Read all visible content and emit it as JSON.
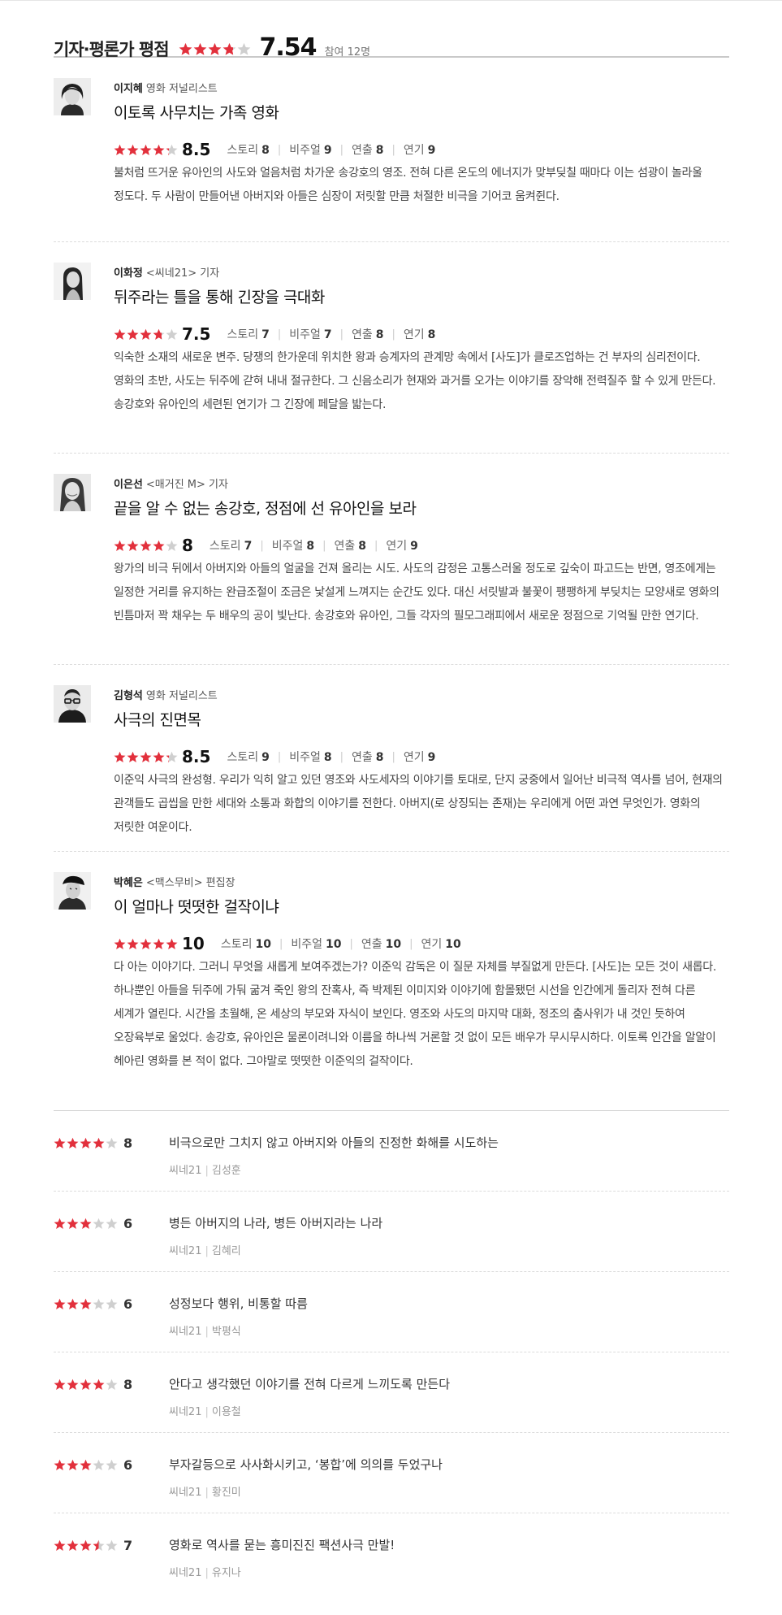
{
  "header": {
    "title": "기자·평론가 평점",
    "rating": 3.77,
    "score": "7.54",
    "participants": "참여 12명"
  },
  "colors": {
    "star_on": "#e2303c",
    "star_off": "#cfcfcf"
  },
  "reviews": [
    {
      "name": "이지혜",
      "role": "영화 저널리스트",
      "title": "이토록 사무치는 가족 영화",
      "rating": 4.25,
      "score": "8.5",
      "sub": [
        {
          "label": "스토리",
          "value": "8"
        },
        {
          "label": "비주얼",
          "value": "9"
        },
        {
          "label": "연출",
          "value": "8"
        },
        {
          "label": "연기",
          "value": "9"
        }
      ],
      "comment": "불처럼 뜨거운 유아인의 사도와 얼음처럼 차가운 송강호의 영조. 전혀 다른 온도의 에너지가 맞부딪칠 때마다 이는 섬광이 놀라울 정도다. 두 사람이 만들어낸 아버지와 아들은 심장이 저릿할 만큼 처절한 비극을 기어코 움켜쥔다.",
      "avatar": "woman-short-hair-icon"
    },
    {
      "name": "이화정",
      "role": "<씨네21> 기자",
      "title": "뒤주라는 틀을 통해 긴장을 극대화",
      "rating": 3.75,
      "score": "7.5",
      "sub": [
        {
          "label": "스토리",
          "value": "7"
        },
        {
          "label": "비주얼",
          "value": "7"
        },
        {
          "label": "연출",
          "value": "8"
        },
        {
          "label": "연기",
          "value": "8"
        }
      ],
      "comment": "익숙한 소재의 새로운 변주. 당쟁의 한가운데 위치한 왕과 승계자의 관계망 속에서 [사도]가 클로즈업하는 건 부자의 심리전이다. 영화의 초반, 사도는 뒤주에 갇혀 내내 절규한다. 그 신음소리가 현재와 과거를 오가는 이야기를 장악해 전력질주 할 수 있게 만든다. 송강호와 유아인의 세련된 연기가 그 긴장에 페달을 밟는다.",
      "avatar": "woman-long-hair-icon"
    },
    {
      "name": "이은선",
      "role": "<매거진 M> 기자",
      "title": "끝을 알 수 없는 송강호, 정점에 선 유아인을 보라",
      "rating": 4,
      "score": "8",
      "sub": [
        {
          "label": "스토리",
          "value": "7"
        },
        {
          "label": "비주얼",
          "value": "8"
        },
        {
          "label": "연출",
          "value": "8"
        },
        {
          "label": "연기",
          "value": "9"
        }
      ],
      "comment": "왕가의 비극 뒤에서 아버지와 아들의 얼굴을 건져 올리는 시도. 사도의 감정은 고통스러울 정도로 깊숙이 파고드는 반면, 영조에게는 일정한 거리를 유지하는 완급조절이 조금은 낯설게 느껴지는 순간도 있다. 대신 서릿발과 불꽃이 팽팽하게 부딪치는 모양새로 영화의 빈틈마저 꽉 채우는 두 배우의 공이 빛난다. 송강호와 유아인, 그들 각자의 필모그래피에서 새로운 정점으로 기억될 만한 연기다.",
      "avatar": "woman-smiling-icon"
    },
    {
      "name": "김형석",
      "role": "영화 저널리스트",
      "title": "사극의 진면목",
      "rating": 4.25,
      "score": "8.5",
      "sub": [
        {
          "label": "스토리",
          "value": "9"
        },
        {
          "label": "비주얼",
          "value": "8"
        },
        {
          "label": "연출",
          "value": "8"
        },
        {
          "label": "연기",
          "value": "9"
        }
      ],
      "comment": "이준익 사극의 완성형. 우리가 익히 알고 있던 영조와 사도세자의 이야기를 토대로, 단지 궁중에서 일어난 비극적 역사를 넘어, 현재의 관객들도 곱씹을 만한 세대와 소통과 화합의 이야기를 전한다. 아버지(로 상징되는 존재)는 우리에게 어떤 과연 무엇인가. 영화의 저릿한 여운이다.",
      "avatar": "man-glasses-icon"
    },
    {
      "name": "박혜은",
      "role": "<맥스무비> 편집장",
      "title": "이 얼마나 떳떳한 걸작이냐",
      "rating": 5,
      "score": "10",
      "sub": [
        {
          "label": "스토리",
          "value": "10"
        },
        {
          "label": "비주얼",
          "value": "10"
        },
        {
          "label": "연출",
          "value": "10"
        },
        {
          "label": "연기",
          "value": "10"
        }
      ],
      "comment": "다 아는 이야기다. 그러니 무엇을 새롭게 보여주겠는가? 이준익 감독은 이 질문 자체를 부질없게 만든다. [사도]는 모든 것이 새롭다. 하나뿐인 아들을 뒤주에 가둬 굶겨 죽인 왕의 잔혹사, 즉 박제된 이미지와 이야기에 함몰됐던 시선을 인간에게 돌리자 전혀 다른 세계가 열린다. 시간을 초월해, 온 세상의 부모와 자식이 보인다. 영조와 사도의 마지막 대화, 정조의 춤사위가 내 것인 듯하여 오장육부로 울었다. 송강호, 유아인은 물론이려니와 이름을 하나씩 거론할 것 없이 모든 배우가 무시무시하다. 이토록 인간을 알알이 헤아린 영화를 본 적이 없다. 그야말로 떳떳한 이준익의 걸작이다.",
      "avatar": "person-cap-icon"
    }
  ],
  "short_reviews": [
    {
      "rating": 4,
      "score": "8",
      "text": "비극으로만 그치지 않고 아버지와 아들의 진정한 화해를 시도하는",
      "source": "씨네21",
      "name": "김성훈"
    },
    {
      "rating": 3,
      "score": "6",
      "text": "병든 아버지의 나라, 병든 아버지라는 나라",
      "source": "씨네21",
      "name": "김혜리"
    },
    {
      "rating": 3,
      "score": "6",
      "text": "성정보다 행위, 비통할 따름",
      "source": "씨네21",
      "name": "박평식"
    },
    {
      "rating": 4,
      "score": "8",
      "text": "안다고 생각했던 이야기를 전혀 다르게 느끼도록 만든다",
      "source": "씨네21",
      "name": "이용철"
    },
    {
      "rating": 3,
      "score": "6",
      "text": "부자갈등으로 사사화시키고, ‘봉합’에 의의를 두었구나",
      "source": "씨네21",
      "name": "황진미"
    },
    {
      "rating": 3.5,
      "score": "7",
      "text": "영화로 역사를 묻는 흥미진진 팩션사극 만발!",
      "source": "씨네21",
      "name": "유지나"
    }
  ]
}
